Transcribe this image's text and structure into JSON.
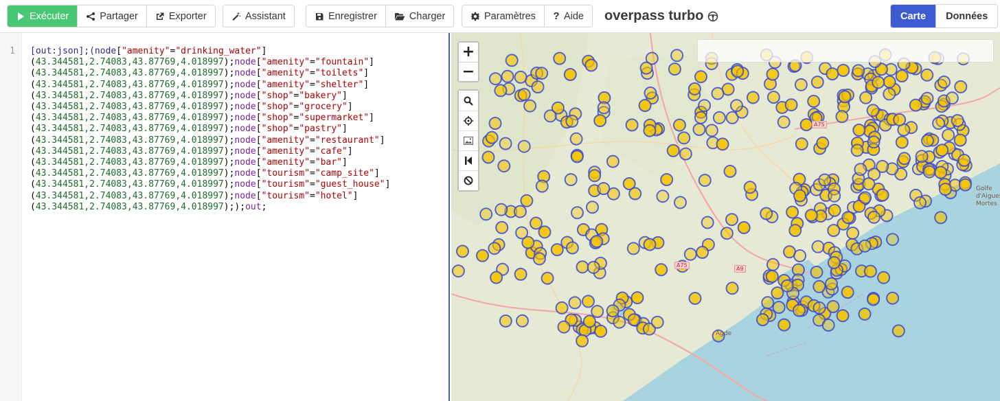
{
  "toolbar": {
    "run_label": "Exécuter",
    "share_label": "Partager",
    "export_label": "Exporter",
    "wizard_label": "Assistant",
    "save_label": "Enregistrer",
    "load_label": "Charger",
    "settings_label": "Paramètres",
    "help_label": "Aide",
    "brand_title": "overpass turbo",
    "view_map_label": "Carte",
    "view_data_label": "Données"
  },
  "editor": {
    "line_number": "1",
    "segments": [
      {
        "t": "[out:json];(",
        "c": "kw"
      },
      {
        "t": "node",
        "c": "kw"
      },
      {
        "t": "[",
        "c": ""
      },
      {
        "t": "\"amenity\"",
        "c": "s"
      },
      {
        "t": "=",
        "c": ""
      },
      {
        "t": "\"drinking_water\"",
        "c": "s"
      },
      {
        "t": "]\n(",
        "c": ""
      },
      {
        "t": "43.344581,2.74083,43.87769,4.018997",
        "c": "n"
      },
      {
        "t": ");",
        "c": ""
      },
      {
        "t": "node",
        "c": "k"
      },
      {
        "t": "[",
        "c": ""
      },
      {
        "t": "\"amenity\"",
        "c": "s"
      },
      {
        "t": "=",
        "c": ""
      },
      {
        "t": "\"fountain\"",
        "c": "s"
      },
      {
        "t": "]\n(",
        "c": ""
      },
      {
        "t": "43.344581,2.74083,43.87769,4.018997",
        "c": "n"
      },
      {
        "t": ");",
        "c": ""
      },
      {
        "t": "node",
        "c": "k"
      },
      {
        "t": "[",
        "c": ""
      },
      {
        "t": "\"amenity\"",
        "c": "s"
      },
      {
        "t": "=",
        "c": ""
      },
      {
        "t": "\"toilets\"",
        "c": "s"
      },
      {
        "t": "]\n(",
        "c": ""
      },
      {
        "t": "43.344581,2.74083,43.87769,4.018997",
        "c": "n"
      },
      {
        "t": ");",
        "c": ""
      },
      {
        "t": "node",
        "c": "k"
      },
      {
        "t": "[",
        "c": ""
      },
      {
        "t": "\"amenity\"",
        "c": "s"
      },
      {
        "t": "=",
        "c": ""
      },
      {
        "t": "\"shelter\"",
        "c": "s"
      },
      {
        "t": "]\n(",
        "c": ""
      },
      {
        "t": "43.344581,2.74083,43.87769,4.018997",
        "c": "n"
      },
      {
        "t": ");",
        "c": ""
      },
      {
        "t": "node",
        "c": "k"
      },
      {
        "t": "[",
        "c": ""
      },
      {
        "t": "\"shop\"",
        "c": "s"
      },
      {
        "t": "=",
        "c": ""
      },
      {
        "t": "\"bakery\"",
        "c": "s"
      },
      {
        "t": "]\n(",
        "c": ""
      },
      {
        "t": "43.344581,2.74083,43.87769,4.018997",
        "c": "n"
      },
      {
        "t": ");",
        "c": ""
      },
      {
        "t": "node",
        "c": "k"
      },
      {
        "t": "[",
        "c": ""
      },
      {
        "t": "\"shop\"",
        "c": "s"
      },
      {
        "t": "=",
        "c": ""
      },
      {
        "t": "\"grocery\"",
        "c": "s"
      },
      {
        "t": "]\n(",
        "c": ""
      },
      {
        "t": "43.344581,2.74083,43.87769,4.018997",
        "c": "n"
      },
      {
        "t": ");",
        "c": ""
      },
      {
        "t": "node",
        "c": "k"
      },
      {
        "t": "[",
        "c": ""
      },
      {
        "t": "\"shop\"",
        "c": "s"
      },
      {
        "t": "=",
        "c": ""
      },
      {
        "t": "\"supermarket\"",
        "c": "s"
      },
      {
        "t": "]\n(",
        "c": ""
      },
      {
        "t": "43.344581,2.74083,43.87769,4.018997",
        "c": "n"
      },
      {
        "t": ");",
        "c": ""
      },
      {
        "t": "node",
        "c": "k"
      },
      {
        "t": "[",
        "c": ""
      },
      {
        "t": "\"shop\"",
        "c": "s"
      },
      {
        "t": "=",
        "c": ""
      },
      {
        "t": "\"pastry\"",
        "c": "s"
      },
      {
        "t": "]\n(",
        "c": ""
      },
      {
        "t": "43.344581,2.74083,43.87769,4.018997",
        "c": "n"
      },
      {
        "t": ");",
        "c": ""
      },
      {
        "t": "node",
        "c": "k"
      },
      {
        "t": "[",
        "c": ""
      },
      {
        "t": "\"amenity\"",
        "c": "s"
      },
      {
        "t": "=",
        "c": ""
      },
      {
        "t": "\"restaurant\"",
        "c": "s"
      },
      {
        "t": "]\n(",
        "c": ""
      },
      {
        "t": "43.344581,2.74083,43.87769,4.018997",
        "c": "n"
      },
      {
        "t": ");",
        "c": ""
      },
      {
        "t": "node",
        "c": "k"
      },
      {
        "t": "[",
        "c": ""
      },
      {
        "t": "\"amenity\"",
        "c": "s"
      },
      {
        "t": "=",
        "c": ""
      },
      {
        "t": "\"cafe\"",
        "c": "s"
      },
      {
        "t": "]\n(",
        "c": ""
      },
      {
        "t": "43.344581,2.74083,43.87769,4.018997",
        "c": "n"
      },
      {
        "t": ");",
        "c": ""
      },
      {
        "t": "node",
        "c": "k"
      },
      {
        "t": "[",
        "c": ""
      },
      {
        "t": "\"amenity\"",
        "c": "s"
      },
      {
        "t": "=",
        "c": ""
      },
      {
        "t": "\"bar\"",
        "c": "s"
      },
      {
        "t": "]\n(",
        "c": ""
      },
      {
        "t": "43.344581,2.74083,43.87769,4.018997",
        "c": "n"
      },
      {
        "t": ");",
        "c": ""
      },
      {
        "t": "node",
        "c": "k"
      },
      {
        "t": "[",
        "c": ""
      },
      {
        "t": "\"tourism\"",
        "c": "s"
      },
      {
        "t": "=",
        "c": ""
      },
      {
        "t": "\"camp_site\"",
        "c": "s"
      },
      {
        "t": "]\n(",
        "c": ""
      },
      {
        "t": "43.344581,2.74083,43.87769,4.018997",
        "c": "n"
      },
      {
        "t": ");",
        "c": ""
      },
      {
        "t": "node",
        "c": "k"
      },
      {
        "t": "[",
        "c": ""
      },
      {
        "t": "\"tourism\"",
        "c": "s"
      },
      {
        "t": "=",
        "c": ""
      },
      {
        "t": "\"guest_house\"",
        "c": "s"
      },
      {
        "t": "]\n(",
        "c": ""
      },
      {
        "t": "43.344581,2.74083,43.87769,4.018997",
        "c": "n"
      },
      {
        "t": ");",
        "c": ""
      },
      {
        "t": "node",
        "c": "k"
      },
      {
        "t": "[",
        "c": ""
      },
      {
        "t": "\"tourism\"",
        "c": "s"
      },
      {
        "t": "=",
        "c": ""
      },
      {
        "t": "\"hotel\"",
        "c": "s"
      },
      {
        "t": "]\n(",
        "c": ""
      },
      {
        "t": "43.344581,2.74083,43.87769,4.018997",
        "c": "n"
      },
      {
        "t": ");",
        "c": ""
      },
      {
        "t": ");",
        "c": ""
      },
      {
        "t": "out",
        "c": "k"
      },
      {
        "t": ";",
        "c": ""
      }
    ]
  },
  "map": {
    "zoom_in": "+",
    "zoom_out": "−",
    "labels": [
      {
        "text": "Agde",
        "name": "map-label-agde"
      },
      {
        "text": "A75",
        "name": "road-a75-north"
      },
      {
        "text": "A75",
        "name": "road-a75-west"
      },
      {
        "text": "A9",
        "name": "road-a9"
      },
      {
        "text": "Golfe d'Aigues-Mortes",
        "name": "map-label-golfe"
      }
    ],
    "icons": {
      "search_tool": "magnifier-icon",
      "locate_tool": "crosshair-icon",
      "image_tool": "image-icon",
      "first_tool": "skip-back-icon",
      "clear_tool": "block-icon"
    },
    "colors": {
      "marker_fill": "#f5c400",
      "marker_stroke": "#2f45d8",
      "sea": "#a9d3df",
      "land": "#e6ead4",
      "accent": "#3e5bd1",
      "run": "#48c774"
    }
  }
}
